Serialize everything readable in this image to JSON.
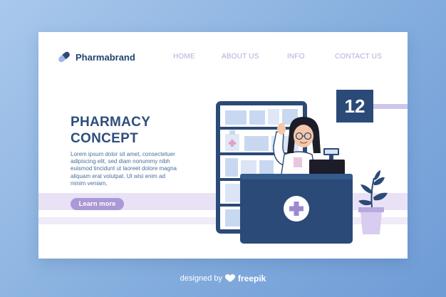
{
  "brand": {
    "name": "Pharmabrand",
    "icon": "capsule-icon"
  },
  "nav": {
    "home": "HOME",
    "about": "ABOUT US",
    "info": "INFO",
    "contact": "CONTACT US"
  },
  "hero": {
    "title_line1": "PHARMACY",
    "title_line2": "CONCEPT",
    "body": "Lorem ipsum dolor sit amet, consectetuer adipiscing elit, sed diam nonummy nibh euismod tincidunt ut laoreet dolore magna aliquam erat volutpat. Ut wisi enim ad minim veniam,",
    "button_label": "Learn more"
  },
  "queue_number": "12",
  "footer": {
    "prefix": "designed by",
    "brand": "freepik",
    "icon": "freepik-logo-icon"
  },
  "colors": {
    "navy": "#2b4a77",
    "lavender": "#ab98d6",
    "nav_text": "#b5a9de",
    "background": "#85aede"
  }
}
